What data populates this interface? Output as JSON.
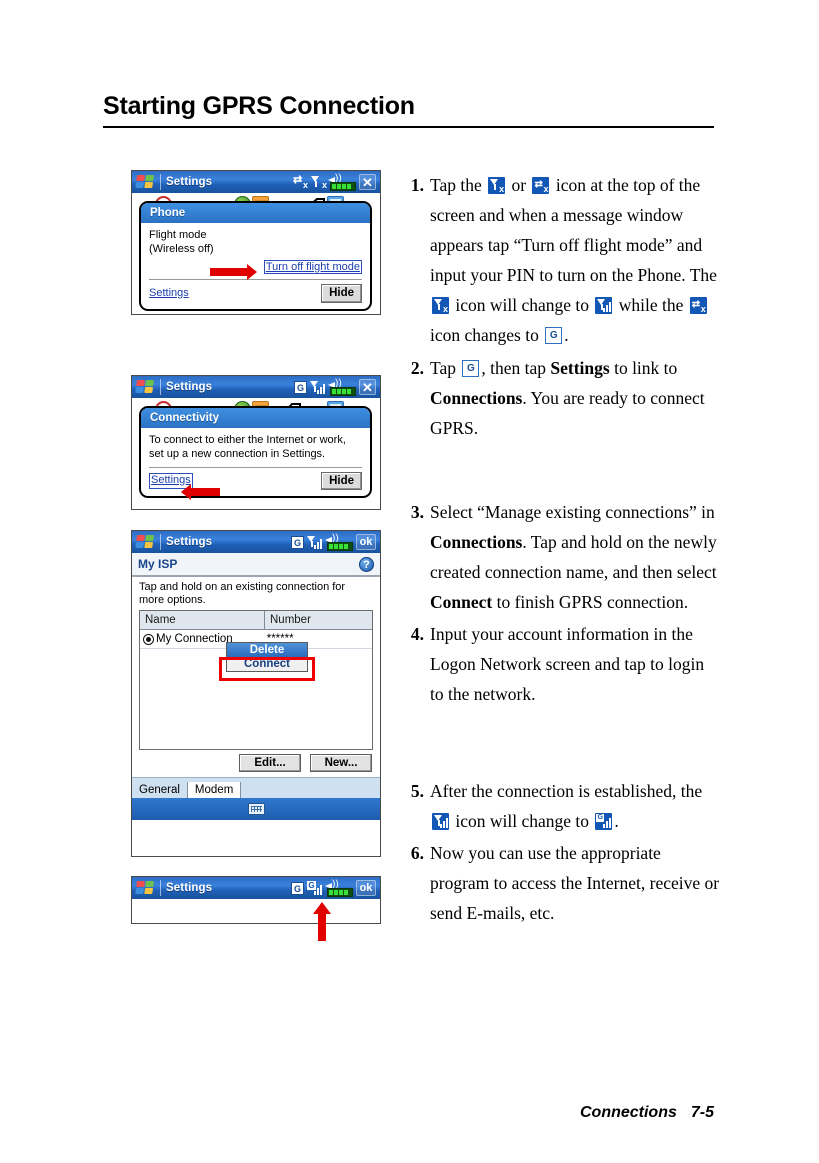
{
  "page": {
    "title": "Starting GPRS Connection",
    "footer_section": "Connections",
    "footer_page": "7-5"
  },
  "screens": [
    {
      "id": "screen-flight-mode",
      "titlebar": {
        "app": "Settings",
        "icons": [
          "connectivity-off-icon",
          "phone-off-icon",
          "speaker-icon",
          "battery-icon"
        ],
        "close_label": "✕"
      },
      "popup": {
        "header": "Phone",
        "body_line1": "Flight mode",
        "body_line2": "(Wireless off)",
        "action_link": "Turn off flight mode",
        "settings_link": "Settings",
        "hide_label": "Hide"
      }
    },
    {
      "id": "screen-connectivity",
      "titlebar": {
        "app": "Settings",
        "gprs_badge": "G",
        "icons": [
          "gprs-icon",
          "signal-icon",
          "speaker-icon",
          "battery-icon"
        ],
        "close_label": "✕"
      },
      "popup": {
        "header": "Connectivity",
        "body_line1": "To connect to either the Internet or work,",
        "body_line2": "set up a new connection in Settings.",
        "settings_link": "Settings",
        "hide_label": "Hide"
      }
    },
    {
      "id": "screen-my-isp",
      "titlebar": {
        "app": "Settings",
        "gprs_badge": "G",
        "ok_label": "ok"
      },
      "header": {
        "title": "My ISP",
        "help_glyph": "?"
      },
      "note": "Tap and hold on an existing connection for more options.",
      "table": {
        "columns": [
          "Name",
          "Number"
        ],
        "rows": [
          {
            "name": "My Connection",
            "number": "******"
          }
        ]
      },
      "context_menu": {
        "items": [
          "Delete",
          "Connect"
        ],
        "highlighted": "Delete",
        "boxed": "Connect"
      },
      "buttons": [
        "Edit...",
        "New..."
      ],
      "tabs": [
        {
          "label": "General",
          "active": false
        },
        {
          "label": "Modem",
          "active": true
        }
      ],
      "soft_keyboard_icon": "keyboard-icon"
    },
    {
      "id": "screen-connected",
      "titlebar": {
        "app": "Settings",
        "gprs_badge": "G",
        "icons": [
          "gprs-connected-icon",
          "speaker-icon",
          "battery-icon"
        ],
        "ok_label": "ok"
      }
    }
  ],
  "steps": [
    {
      "num": "1.",
      "parts": [
        {
          "t": "text",
          "v": "Tap the "
        },
        {
          "t": "icon",
          "v": "phone-off-icon"
        },
        {
          "t": "text",
          "v": " or "
        },
        {
          "t": "icon",
          "v": "connectivity-off-icon"
        },
        {
          "t": "text",
          "v": " icon at the top of the screen and when a message window appears tap “Turn off flight mode” and input your PIN to turn on the Phone. The "
        },
        {
          "t": "icon",
          "v": "phone-off-icon"
        },
        {
          "t": "text",
          "v": " icon will change to "
        },
        {
          "t": "icon",
          "v": "signal-icon"
        },
        {
          "t": "text",
          "v": " while the "
        },
        {
          "t": "icon",
          "v": "connectivity-off-icon"
        },
        {
          "t": "text",
          "v": " icon changes to "
        },
        {
          "t": "icon",
          "v": "gprs-badge-icon"
        },
        {
          "t": "text",
          "v": "."
        }
      ]
    },
    {
      "num": "2.",
      "parts": [
        {
          "t": "text",
          "v": "Tap "
        },
        {
          "t": "icon",
          "v": "gprs-badge-icon"
        },
        {
          "t": "text",
          "v": ", then tap "
        },
        {
          "t": "bold",
          "v": "Settings"
        },
        {
          "t": "text",
          "v": " to link to "
        },
        {
          "t": "bold",
          "v": "Connections"
        },
        {
          "t": "text",
          "v": ". You are ready to connect GPRS."
        }
      ]
    },
    {
      "num": "3.",
      "parts": [
        {
          "t": "text",
          "v": "Select “Manage existing connections” in "
        },
        {
          "t": "bold",
          "v": "Connections"
        },
        {
          "t": "text",
          "v": ". Tap and hold on the newly created connection name, and then select "
        },
        {
          "t": "bold",
          "v": "Connect"
        },
        {
          "t": "text",
          "v": " to finish GPRS connection."
        }
      ]
    },
    {
      "num": "4.",
      "parts": [
        {
          "t": "text",
          "v": "Input your account information in the Logon Network screen and tap to login to the network."
        }
      ]
    },
    {
      "num": "5.",
      "parts": [
        {
          "t": "text",
          "v": "After the connection is established, the "
        },
        {
          "t": "icon",
          "v": "signal-icon"
        },
        {
          "t": "text",
          "v": " icon will change to "
        },
        {
          "t": "icon",
          "v": "gprs-connected-icon"
        },
        {
          "t": "text",
          "v": "."
        }
      ]
    },
    {
      "num": "6.",
      "parts": [
        {
          "t": "text",
          "v": "Now you can use the appropriate program to access the Internet, receive or send E-mails, etc."
        }
      ]
    }
  ],
  "colors": {
    "titlebar_blue": "#2d6cc4",
    "icon_blue": "#1257b5",
    "link_blue": "#1b3fb0",
    "arrow_red": "#e00000",
    "highlight_red": "#ee0000"
  }
}
